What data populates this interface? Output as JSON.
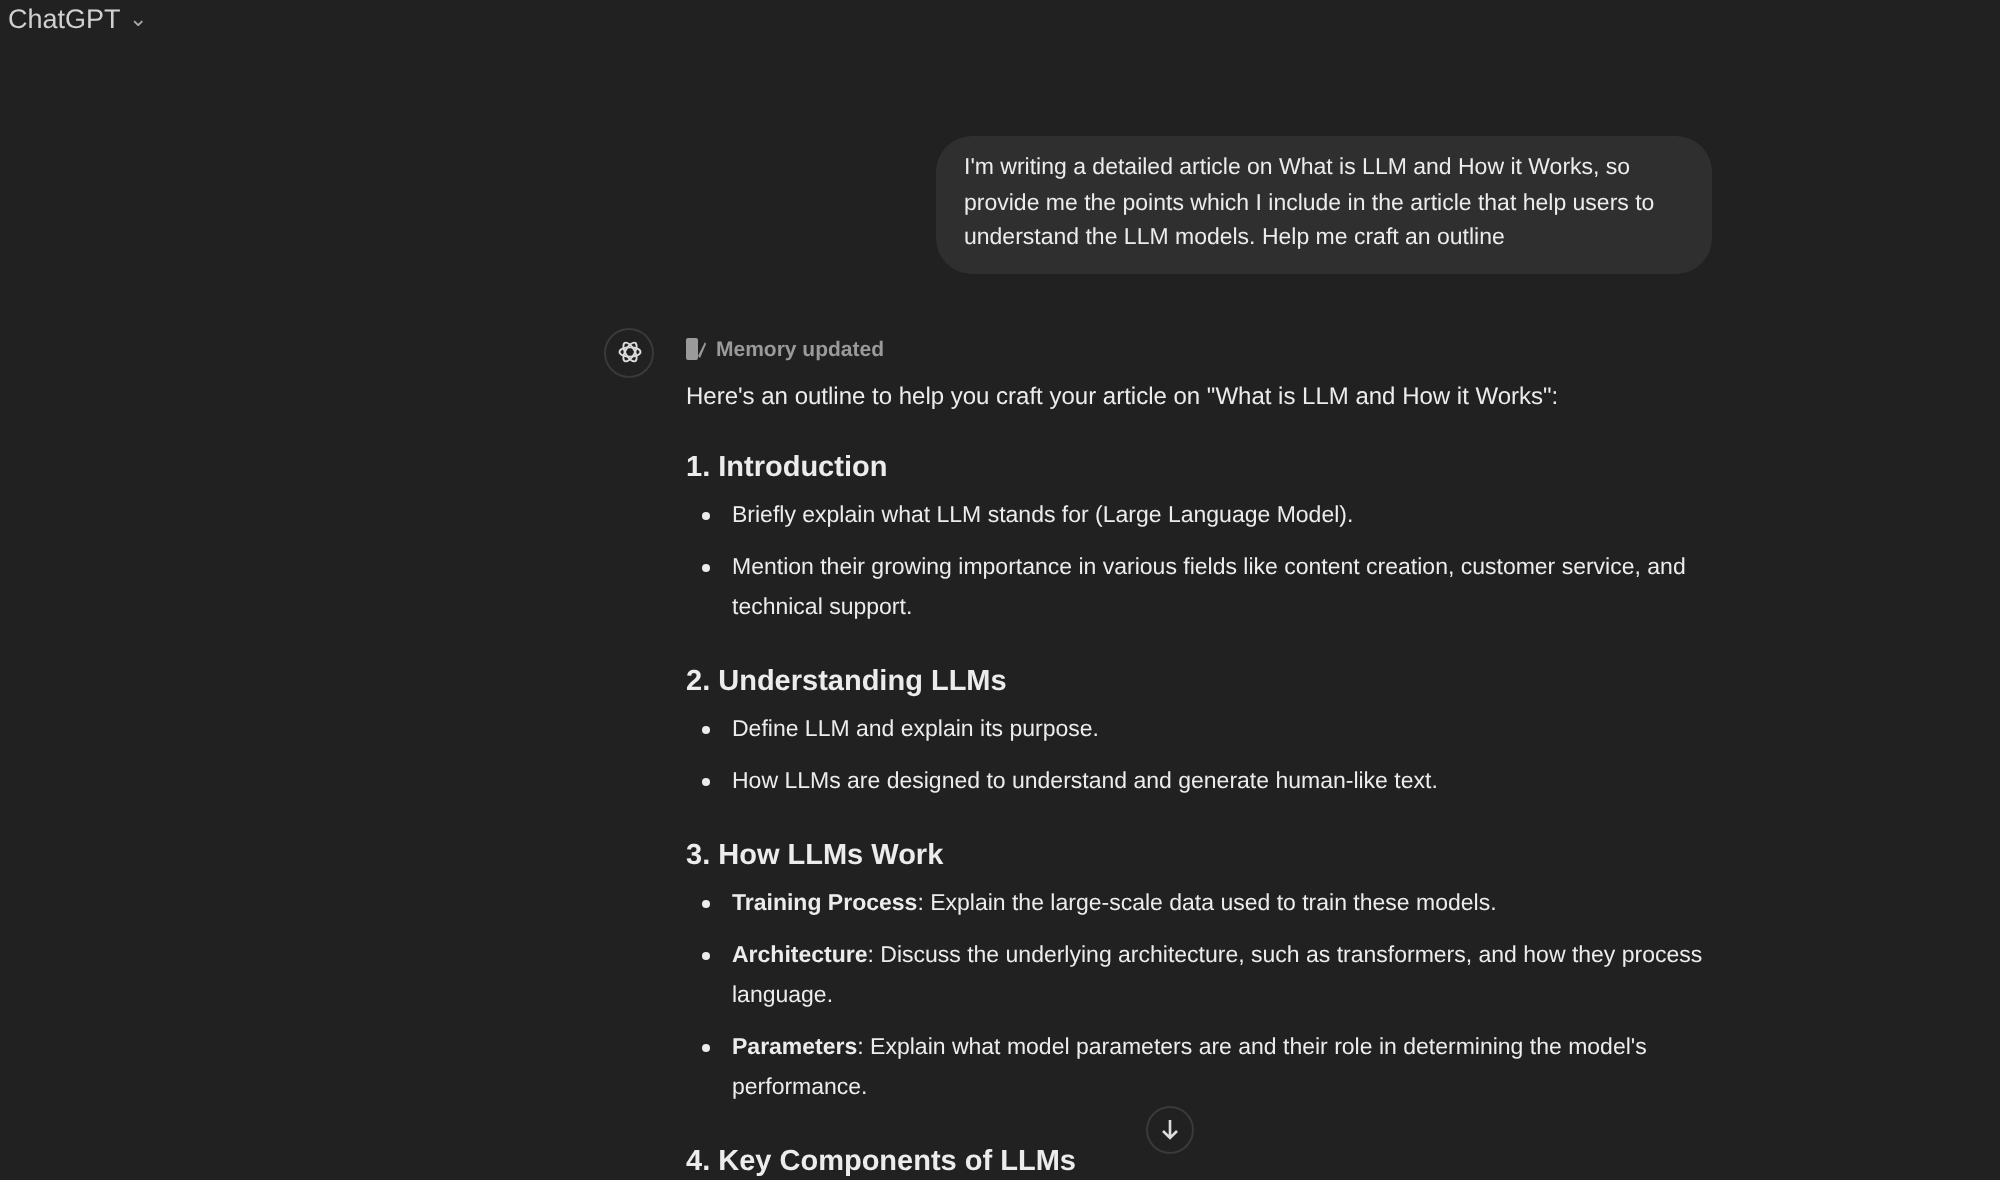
{
  "header": {
    "title": "ChatGPT",
    "caret": "⌄"
  },
  "user_message": "I'm writing a detailed article on What is LLM and How it Works, so provide me the points which I include in the article that help users to understand the LLM models. Help me craft an outline",
  "assistant": {
    "memory_note": "Memory updated",
    "intro": "Here's an outline to help you craft your article on \"What is LLM and How it Works\":",
    "sections": [
      {
        "heading": "1. Introduction",
        "bullets": [
          "Briefly explain what LLM stands for (Large Language Model).",
          "Mention their growing importance in various fields like content creation, customer service, and technical support."
        ]
      },
      {
        "heading": "2. Understanding LLMs",
        "bullets": [
          "Define LLM and explain its purpose.",
          "How LLMs are designed to understand and generate human-like text."
        ]
      },
      {
        "heading": "3. How LLMs Work",
        "bullets": [
          "**Training Process**: Explain the large-scale data used to train these models.",
          "**Architecture**: Discuss the underlying architecture, such as transformers, and how they process language.",
          "**Parameters**: Explain what model parameters are and their role in determining the model's performance."
        ]
      },
      {
        "heading": "4. Key Components of LLMs"
      }
    ]
  }
}
